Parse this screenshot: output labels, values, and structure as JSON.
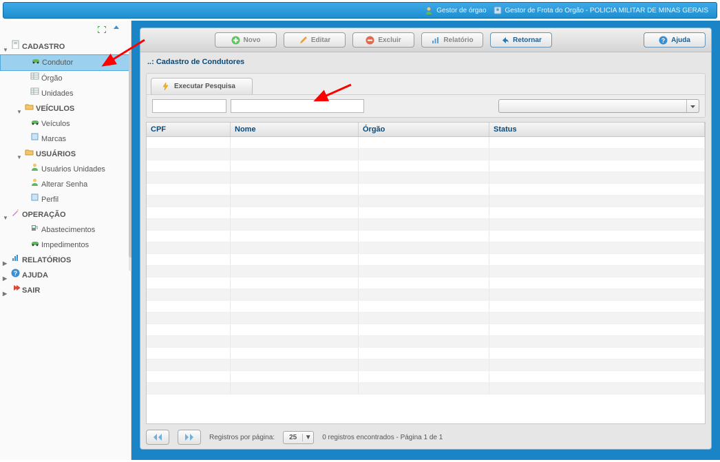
{
  "header": {
    "user_role": "Gestor de órgao",
    "user_context": "Gestor de Frota do Orgão - POLICIA MILITAR DE MINAS GERAIS"
  },
  "sidebar": {
    "nodes": [
      {
        "label": "CADASTRO",
        "level": 1,
        "expanded": true,
        "icon": "doc"
      },
      {
        "label": "Condutor",
        "level": 3,
        "icon": "car-green",
        "selected": true
      },
      {
        "label": "Órgão",
        "level": 3,
        "icon": "grid"
      },
      {
        "label": "Unidades",
        "level": 3,
        "icon": "grid"
      },
      {
        "label": "VEÍCULOS",
        "level": 2,
        "expanded": true,
        "icon": "folder"
      },
      {
        "label": "Veículos",
        "level": 3,
        "icon": "car-green"
      },
      {
        "label": "Marcas",
        "level": 3,
        "icon": "tag"
      },
      {
        "label": "USUÁRIOS",
        "level": 2,
        "expanded": true,
        "icon": "folder"
      },
      {
        "label": "Usuários Unidades",
        "level": 3,
        "icon": "user"
      },
      {
        "label": "Alterar Senha",
        "level": 3,
        "icon": "user"
      },
      {
        "label": "Perfil",
        "level": 3,
        "icon": "tag"
      },
      {
        "label": "OPERAÇÃO",
        "level": 1,
        "expanded": true,
        "icon": "wand"
      },
      {
        "label": "Abastecimentos",
        "level": 3,
        "icon": "pump"
      },
      {
        "label": "Impedimentos",
        "level": 3,
        "icon": "car-green"
      },
      {
        "label": "RELATÓRIOS",
        "level": 1,
        "expanded": false,
        "icon": "chart"
      },
      {
        "label": "AJUDA",
        "level": 1,
        "expanded": false,
        "icon": "help"
      },
      {
        "label": "SAIR",
        "level": 1,
        "expanded": false,
        "icon": "exit"
      }
    ]
  },
  "toolbar": {
    "novo": "Novo",
    "editar": "Editar",
    "excluir": "Excluir",
    "relatorio": "Relatório",
    "retornar": "Retornar",
    "ajuda": "Ajuda"
  },
  "panel": {
    "title": "..: Cadastro de Condutores",
    "search_button": "Executar Pesquisa"
  },
  "filters": {
    "cpf_value": "",
    "nome_value": "",
    "combo_value": ""
  },
  "grid": {
    "columns": {
      "cpf": "CPF",
      "nome": "Nome",
      "orgao": "Órgão",
      "status": "Status"
    },
    "rows": []
  },
  "pager": {
    "label": "Registros por página:",
    "page_size": "25",
    "status": "0 registros encontrados - Página 1 de 1"
  }
}
